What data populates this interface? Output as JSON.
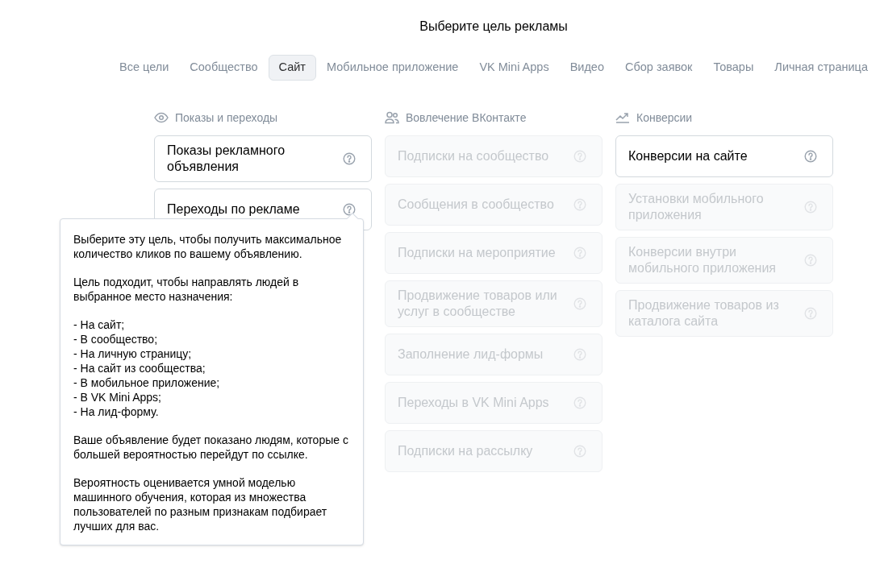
{
  "title": "Выберите цель рекламы",
  "tabs": [
    {
      "label": "Все цели",
      "selected": false
    },
    {
      "label": "Сообщество",
      "selected": false
    },
    {
      "label": "Сайт",
      "selected": true
    },
    {
      "label": "Мобильное приложение",
      "selected": false
    },
    {
      "label": "VK Mini Apps",
      "selected": false
    },
    {
      "label": "Видео",
      "selected": false
    },
    {
      "label": "Сбор заявок",
      "selected": false
    },
    {
      "label": "Товары",
      "selected": false
    },
    {
      "label": "Личная страница",
      "selected": false
    }
  ],
  "columns": [
    {
      "kind": "eye",
      "heading": "Показы и переходы",
      "goals": [
        {
          "label": "Показы рекламного объявления",
          "disabled": false
        },
        {
          "label": "Переходы по рекламе",
          "disabled": false
        }
      ]
    },
    {
      "kind": "people",
      "heading": "Вовлечение ВКонтакте",
      "goals": [
        {
          "label": "Подписки на сообщество",
          "disabled": true
        },
        {
          "label": "Сообщения в сообщество",
          "disabled": true
        },
        {
          "label": "Подписки на мероприятие",
          "disabled": true
        },
        {
          "label": "Продвижение товаров или услуг в сообществе",
          "disabled": true
        },
        {
          "label": "Заполнение лид-формы",
          "disabled": true
        },
        {
          "label": "Переходы в VK Mini Apps",
          "disabled": true
        },
        {
          "label": "Подписки на рассылку",
          "disabled": true
        }
      ]
    },
    {
      "kind": "trend",
      "heading": "Конверсии",
      "goals": [
        {
          "label": "Конверсии на сайте",
          "disabled": false
        },
        {
          "label": "Установки мобильного приложения",
          "disabled": true
        },
        {
          "label": "Конверсии внутри мобильного приложения",
          "disabled": true
        },
        {
          "label": "Продвижение товаров из каталога сайта",
          "disabled": true
        }
      ]
    }
  ],
  "tooltip": {
    "blocks": [
      {
        "kind": "text",
        "text": "Выберите эту цель, чтобы получить максимальное количество кликов по вашему объявлению."
      },
      {
        "kind": "text",
        "text": "Цель подходит, чтобы направлять людей в выбранное место назначения:"
      },
      {
        "kind": "list",
        "items": [
          "- На сайт;",
          "- В сообщество;",
          "- На личную страницу;",
          "- На сайт из сообщества;",
          "- В мобильное приложение;",
          "- В VK Mini Apps;",
          "- На лид-форму."
        ]
      },
      {
        "kind": "text",
        "text": "Ваше объявление будет показано людям, которые с большей вероятностью перейдут по ссылке."
      },
      {
        "kind": "text",
        "text": "Вероятность оценивается умной моделью машинного обучения, которая из множества пользователей по разным признакам подбирает лучших для вас."
      }
    ]
  }
}
